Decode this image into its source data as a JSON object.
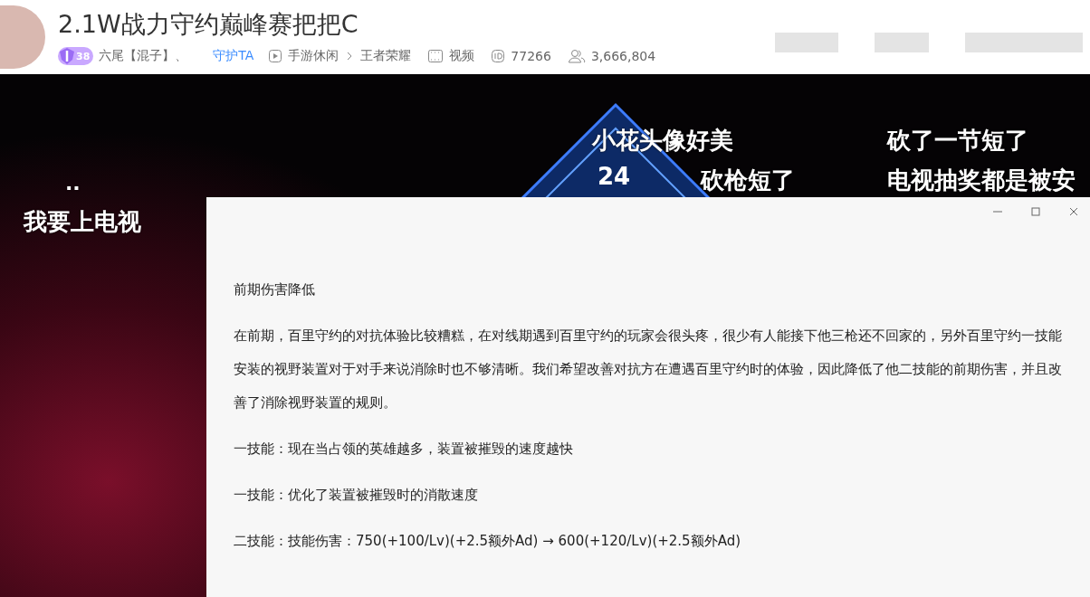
{
  "header": {
    "title": "2.1W战力守约巅峰赛把把C",
    "level_badge": "38",
    "streamer": "六尾【混子】、",
    "guard_link": "守护TA",
    "category": "手游休闲",
    "game": "王者荣耀",
    "tag": "视频",
    "room_id": "77266",
    "followers": "3,666,804"
  },
  "video": {
    "rank_number": "24",
    "danmaku": [
      {
        "text": ".."
      },
      {
        "text": "我要上电视"
      },
      {
        "text": "小花头像好美"
      },
      {
        "text": "砍枪短了"
      },
      {
        "text": "砍了一节短了"
      },
      {
        "text": "电视抽奖都是被安"
      }
    ]
  },
  "window": {
    "heading": "前期伤害降低",
    "paragraphs": [
      "在前期，百里守约的对抗体验比较糟糕，在对线期遇到百里守约的玩家会很头疼，很少有人能接下他三枪还不回家的，另外百里守约一技能安装的视野装置对于对手来说消除时也不够清晰。我们希望改善对抗方在遭遇百里守约时的体验，因此降低了他二技能的前期伤害，并且改善了消除视野装置的规则。",
      "一技能：现在当占领的英雄越多，装置被摧毁的速度越快",
      "一技能：优化了装置被摧毁时的消散速度",
      "二技能：技能伤害：750(+100/Lv)(+2.5额外Ad) → 600(+120/Lv)(+2.5额外Ad)"
    ]
  }
}
